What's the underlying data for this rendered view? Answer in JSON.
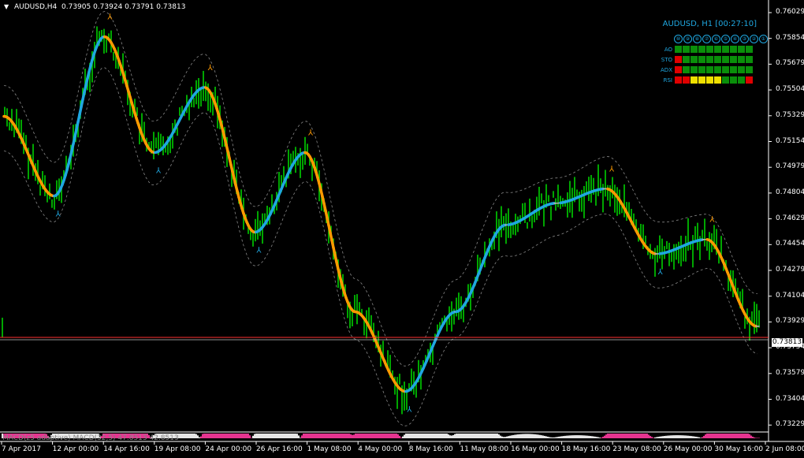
{
  "header": {
    "symbol_tf": "AUDUSD,H4",
    "ohlc": "0.73905 0.73924 0.73791 0.73813"
  },
  "panel": {
    "title": "AUDUSD, H1 [00:27:10]",
    "timeframes": [
      "⑩",
      "⑨",
      "⑧",
      "⑦",
      "⑥",
      "⑤",
      "④",
      "③",
      "②",
      "①"
    ],
    "rows": [
      {
        "label": "AO",
        "cells": [
          "G",
          "G",
          "G",
          "G",
          "G",
          "G",
          "G",
          "G",
          "G",
          "G"
        ]
      },
      {
        "label": "STO",
        "cells": [
          "R",
          "G",
          "G",
          "G",
          "G",
          "G",
          "G",
          "G",
          "G",
          "G"
        ]
      },
      {
        "label": "ADX",
        "cells": [
          "R",
          "G",
          "G",
          "G",
          "G",
          "G",
          "G",
          "G",
          "G",
          "G"
        ]
      },
      {
        "label": "RSI",
        "cells": [
          "R",
          "R",
          "Y",
          "Y",
          "Y",
          "Y",
          "G",
          "G",
          "G",
          "R"
        ]
      }
    ],
    "colors": {
      "G": "#0a8f0a",
      "R": "#e00000",
      "Y": "#f0e000"
    }
  },
  "price_axis": [
    "0.76029",
    "0.75854",
    "0.75679",
    "0.75504",
    "0.75329",
    "0.75154",
    "0.74979",
    "0.74804",
    "0.74629",
    "0.74454",
    "0.74279",
    "0.74104",
    "0.73929",
    "0.73754",
    "0.73579",
    "0.73404",
    "0.73229"
  ],
  "current_price": "0.73813",
  "date_axis": [
    "7 Apr 2017",
    "12 Apr 00:00",
    "14 Apr 16:00",
    "19 Apr 08:00",
    "24 Apr 00:00",
    "26 Apr 16:00",
    "1 May 08:00",
    "4 May 00:00",
    "8 May 16:00",
    "11 May 08:00",
    "16 May 00:00",
    "18 May 16:00",
    "23 May 08:00",
    "26 May 00:00",
    "30 May 16:00",
    "2 Jun 08:00"
  ],
  "macd_label": "MACD(z5 adaptive) MACD(32,5) 47.8513 42.8513",
  "chart_data": {
    "type": "line",
    "symbol": "AUDUSD",
    "timeframe": "H4",
    "ylim": [
      0.7317,
      0.7611
    ],
    "x": [
      "7 Apr 2017",
      "12 Apr 00:00",
      "14 Apr 16:00",
      "19 Apr 08:00",
      "24 Apr 00:00",
      "26 Apr 16:00",
      "1 May 08:00",
      "4 May 00:00",
      "8 May 16:00",
      "11 May 08:00",
      "16 May 00:00",
      "18 May 16:00",
      "23 May 08:00",
      "26 May 00:00",
      "30 May 16:00",
      "2 Jun 08:00"
    ],
    "series": [
      {
        "values": [
          0.7535,
          0.748,
          0.759,
          0.751,
          0.7555,
          0.7455,
          0.751,
          0.74,
          0.7345,
          0.74,
          0.746,
          0.7475,
          0.7485,
          0.744,
          0.745,
          0.739
        ]
      }
    ],
    "colors": {
      "up_trend": "#1fa7e0",
      "down_trend": "#ff9a00",
      "neutral": "#b0b0b0",
      "bars": "#00d000",
      "macd_pos": "#ffffff",
      "macd_neg": "#ff3aa0",
      "price_line": "#ff3030"
    }
  }
}
